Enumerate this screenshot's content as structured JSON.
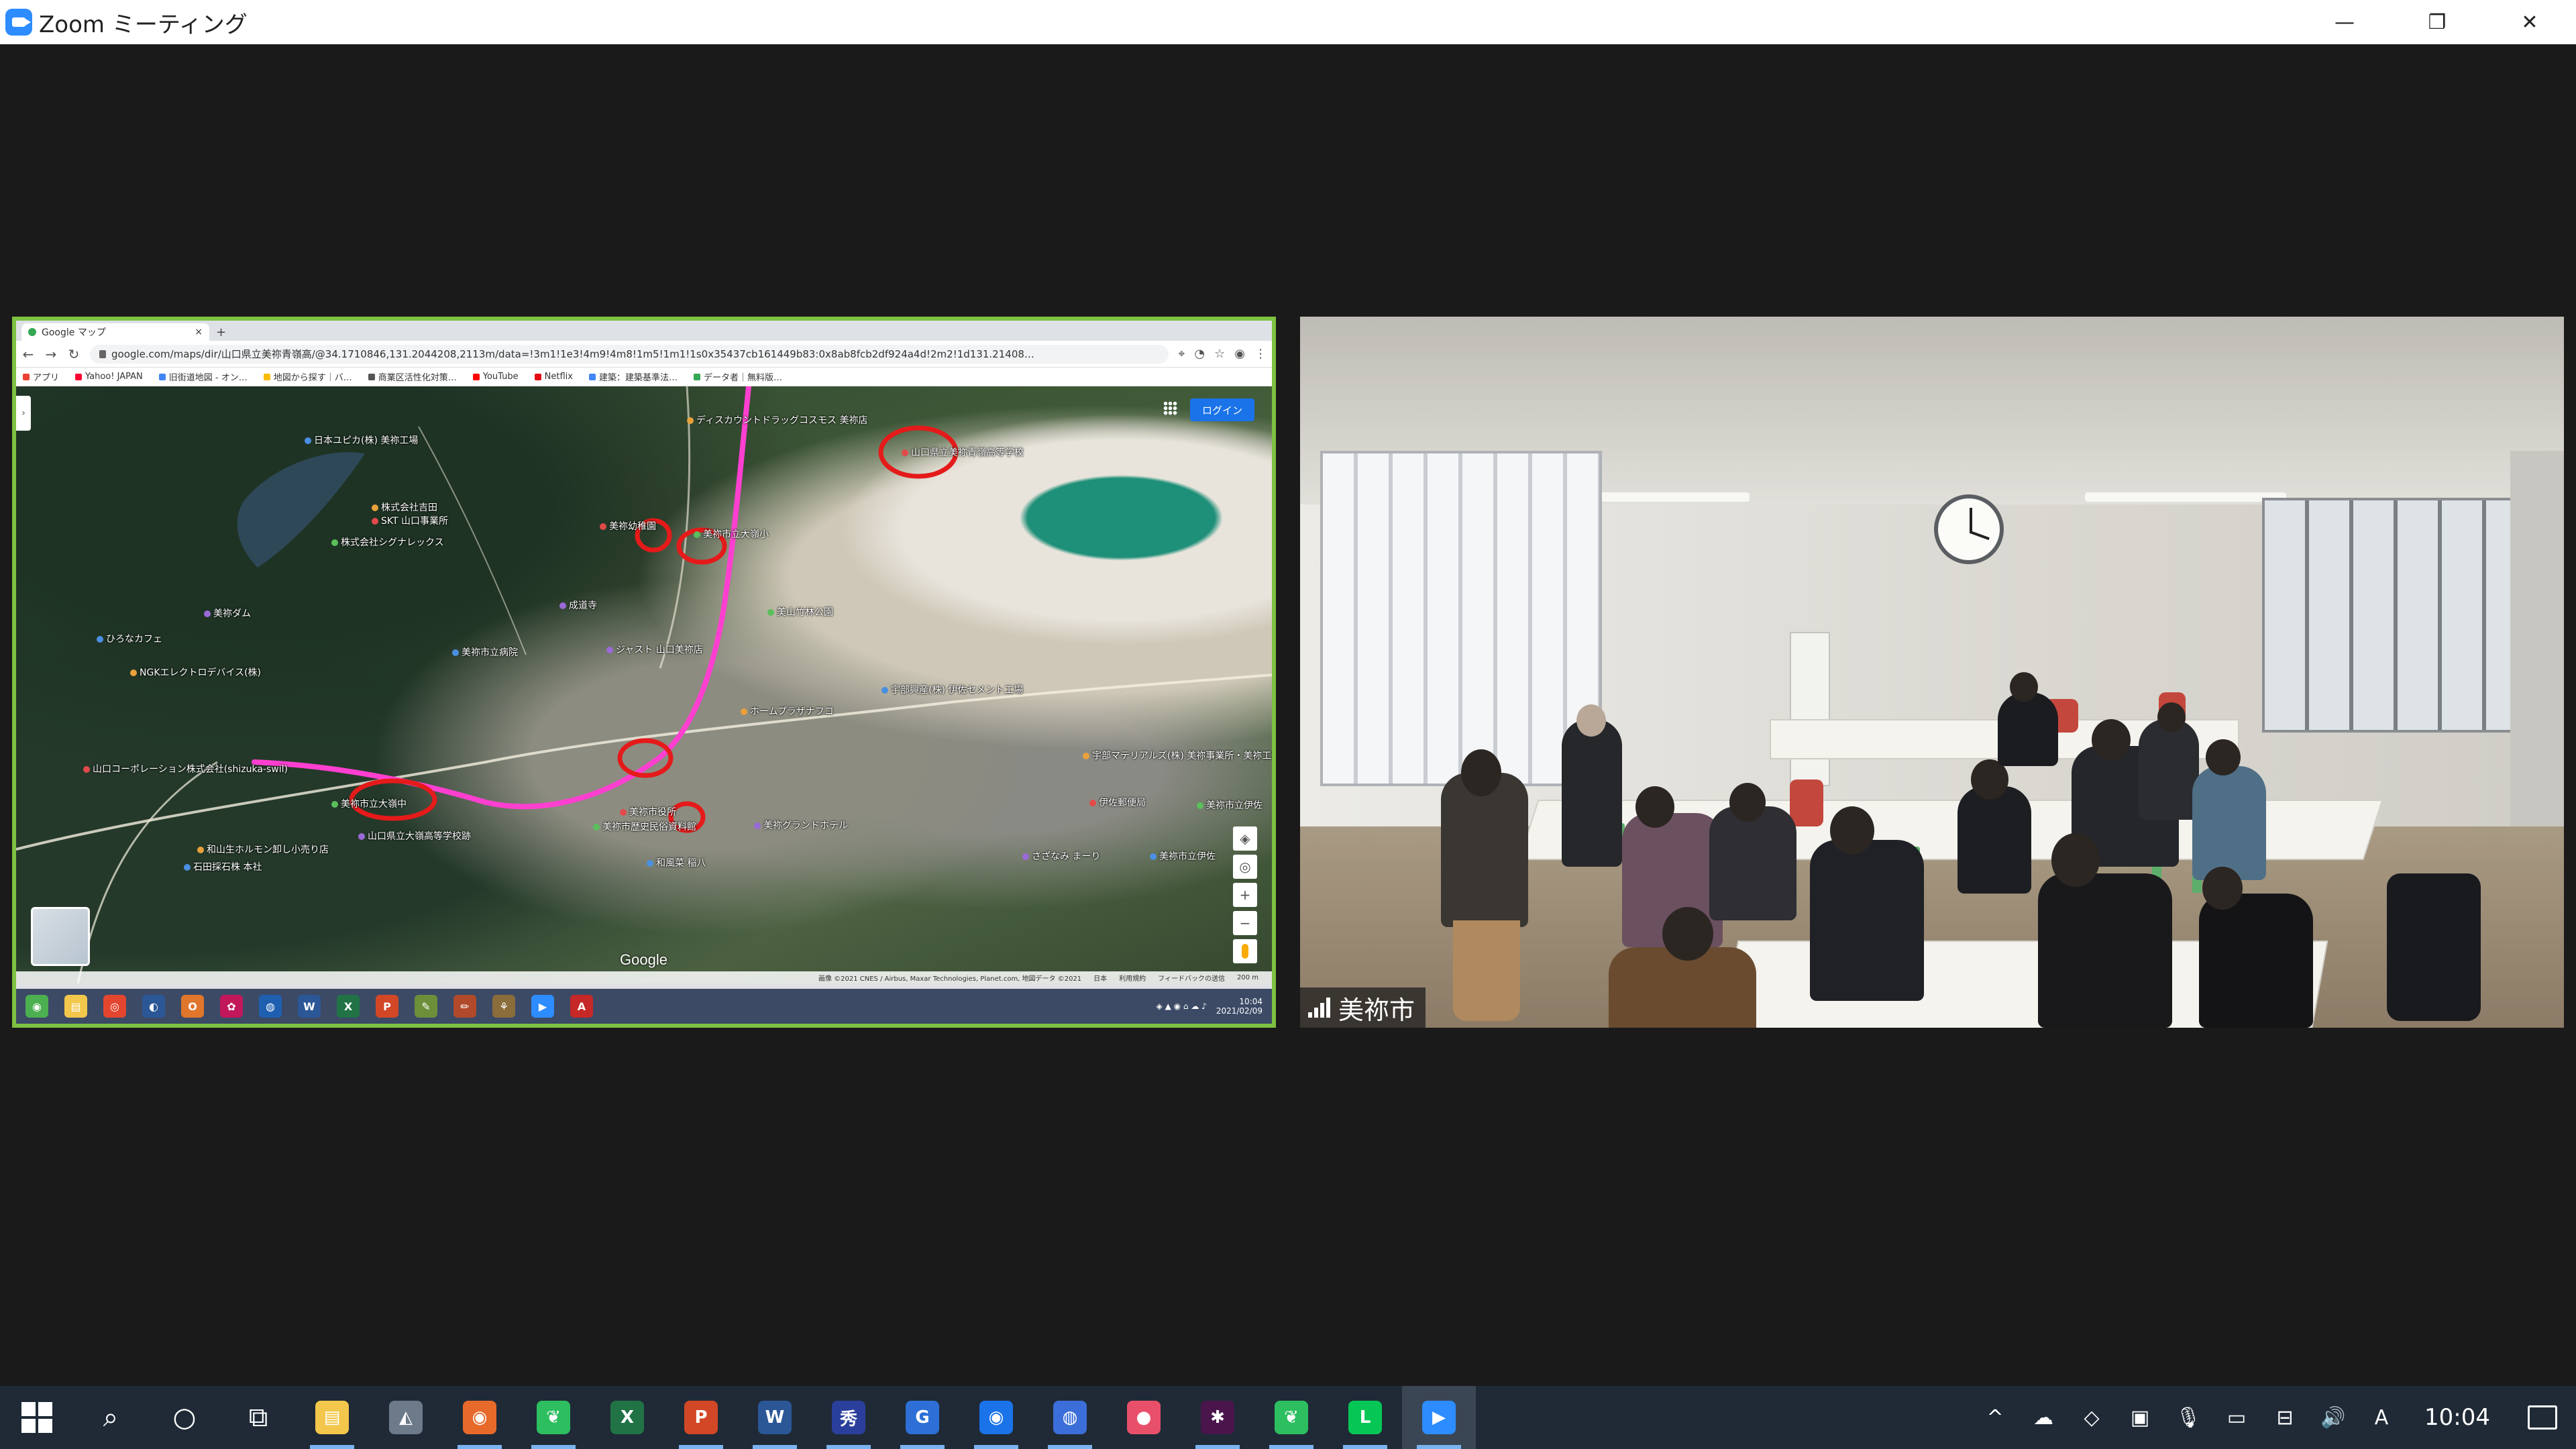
{
  "window": {
    "title": "Zoom ミーティング",
    "controls": {
      "minimize": "—",
      "restore": "❐",
      "close": "✕"
    }
  },
  "browser": {
    "tab_title": "Google マップ",
    "tab_close": "×",
    "new_tab": "+",
    "address": "google.com/maps/dir/山口県立美祢青嶺高/@34.1710846,131.2044208,2113m/data=!3m1!1e3!4m9!4m8!1m5!1m1!1s0x35437cb161449b83:0x8ab8fcb2df924a4d!2m2!1d131.21408…",
    "bookmarks": [
      {
        "label": "アプリ",
        "color": "#ea4335"
      },
      {
        "label": "Yahoo! JAPAN",
        "color": "#ff0033"
      },
      {
        "label": "旧街道地図 - オン…",
        "color": "#4285f4"
      },
      {
        "label": "地図から探す｜バ…",
        "color": "#fbbc05"
      },
      {
        "label": "商業区活性化対策…",
        "color": "#555555"
      },
      {
        "label": "YouTube",
        "color": "#ff0000"
      },
      {
        "label": "Netflix",
        "color": "#e50914"
      },
      {
        "label": "建築：建築基準法…",
        "color": "#4285f4"
      },
      {
        "label": "データ者｜無料版…",
        "color": "#34a853"
      }
    ]
  },
  "map": {
    "login": "ログイン",
    "google": "Google",
    "labels": [
      {
        "text": "日本ユピカ(株) 美祢工場"
      },
      {
        "text": "株式会社吉田"
      },
      {
        "text": "SKT 山口事業所"
      },
      {
        "text": "株式会社シグナレックス"
      },
      {
        "text": "美祢ダム"
      },
      {
        "text": "ひろなカフェ"
      },
      {
        "text": "NGKエレクトロデバイス(株)"
      },
      {
        "text": "山口コーポレーション株式会社(shizuka-swil)"
      },
      {
        "text": "美祢市立大嶺中"
      },
      {
        "text": "山口県立大嶺高等学校跡"
      },
      {
        "text": "石田採石株 本社"
      },
      {
        "text": "和山生ホルモン卸し小売り店"
      },
      {
        "text": "美祢幼稚園"
      },
      {
        "text": "美祢市立大嶺小"
      },
      {
        "text": "成道寺"
      },
      {
        "text": "美祢市立病院"
      },
      {
        "text": "ディスカウントドラッグコスモス 美祢店"
      },
      {
        "text": "山口県立美祢青嶺高等学校"
      },
      {
        "text": "美山竹林公園"
      },
      {
        "text": "ジャスト 山口美祢店"
      },
      {
        "text": "宇部興産(株) 伊佐セメント工場"
      },
      {
        "text": "ホームプラザナフコ"
      },
      {
        "text": "美祢市役所"
      },
      {
        "text": "美祢市歴史民俗資料館"
      },
      {
        "text": "美祢グランドホテル"
      },
      {
        "text": "和風菜 稲八"
      },
      {
        "text": "宇部マテリアルズ(株) 美祢事業所・美祢工場"
      },
      {
        "text": "伊佐郵便局"
      },
      {
        "text": "美祢市立伊佐"
      },
      {
        "text": "さざなみ まーり"
      },
      {
        "text": "美祢市立伊佐"
      }
    ],
    "footer": [
      "画像 ©2021 CNES / Airbus, Maxar Technologies, Planet.com, 地図データ ©2021",
      "日本",
      "利用規約",
      "フィードバックの送信",
      "200 m"
    ]
  },
  "inner_taskbar": {
    "apps": [
      {
        "glyph": "◉",
        "color": "#4caf50"
      },
      {
        "glyph": "▤",
        "color": "#f3c74b"
      },
      {
        "glyph": "◎",
        "color": "#e3452f"
      },
      {
        "glyph": "◐",
        "color": "#2b5797"
      },
      {
        "glyph": "O",
        "color": "#e0762b"
      },
      {
        "glyph": "✿",
        "color": "#c2185b"
      },
      {
        "glyph": "◍",
        "color": "#1f5fb0"
      },
      {
        "glyph": "W",
        "color": "#2b5797"
      },
      {
        "glyph": "X",
        "color": "#217346"
      },
      {
        "glyph": "P",
        "color": "#d24726"
      },
      {
        "glyph": "✎",
        "color": "#6d8f3a"
      },
      {
        "glyph": "✏",
        "color": "#b04a2a"
      },
      {
        "glyph": "⚘",
        "color": "#8a6d3b"
      },
      {
        "glyph": "▶",
        "color": "#2d8cff"
      },
      {
        "glyph": "A",
        "color": "#c62828"
      }
    ],
    "time": "10:04",
    "date": "2021/02/09"
  },
  "participant": {
    "name": "美祢市"
  },
  "taskbar": {
    "apps": [
      {
        "name": "search-icon",
        "glyph": "⌕",
        "color": "transparent",
        "active": false
      },
      {
        "name": "cortana-icon",
        "glyph": "○",
        "color": "transparent",
        "active": false
      },
      {
        "name": "task-view-icon",
        "glyph": "⧉",
        "color": "transparent",
        "active": false
      },
      {
        "name": "file-explorer-icon",
        "glyph": "▤",
        "color": "#f3c74b",
        "active": true
      },
      {
        "name": "hat-icon",
        "glyph": "◭",
        "color": "#6c7a89",
        "active": false
      },
      {
        "name": "firefox-icon",
        "glyph": "◉",
        "color": "#e76a2a",
        "active": true
      },
      {
        "name": "evernote-icon",
        "glyph": "❦",
        "color": "#2dbe60",
        "active": true
      },
      {
        "name": "excel-icon",
        "glyph": "X",
        "color": "#217346",
        "active": false
      },
      {
        "name": "powerpoint-icon",
        "glyph": "P",
        "color": "#d24726",
        "active": true
      },
      {
        "name": "word-icon",
        "glyph": "W",
        "color": "#2b5797",
        "active": true
      },
      {
        "name": "kanji-app-icon",
        "glyph": "秀",
        "color": "#2a3f9c",
        "active": true
      },
      {
        "name": "app-g-icon",
        "glyph": "G",
        "color": "#2d6fd6",
        "active": true
      },
      {
        "name": "app-circle-icon",
        "glyph": "◉",
        "color": "#1a73e8",
        "active": true
      },
      {
        "name": "gamepad-icon",
        "glyph": "◍",
        "color": "#3b6ed8",
        "active": true
      },
      {
        "name": "drop-icon",
        "glyph": "●",
        "color": "#e8506a",
        "active": false
      },
      {
        "name": "slack-icon",
        "glyph": "✱",
        "color": "#4a154b",
        "active": true
      },
      {
        "name": "evernote2-icon",
        "glyph": "❦",
        "color": "#2dbe60",
        "active": true
      },
      {
        "name": "line-icon",
        "glyph": "L",
        "color": "#06c755",
        "active": true
      },
      {
        "name": "zoom-icon",
        "glyph": "▶",
        "color": "#2d8cff",
        "active": true,
        "current": true
      }
    ],
    "tray": [
      {
        "name": "chevron-up-icon",
        "glyph": "^"
      },
      {
        "name": "onedrive-icon",
        "glyph": "☁"
      },
      {
        "name": "dropbox-icon",
        "glyph": "◇"
      },
      {
        "name": "meet-now-icon",
        "glyph": "▣"
      },
      {
        "name": "microphone-icon",
        "glyph": "🎙"
      },
      {
        "name": "battery-icon",
        "glyph": "▭"
      },
      {
        "name": "network-icon",
        "glyph": "⊟"
      },
      {
        "name": "volume-icon",
        "glyph": "🔊"
      },
      {
        "name": "ime-icon",
        "glyph": "A"
      }
    ],
    "time": "10:04"
  }
}
